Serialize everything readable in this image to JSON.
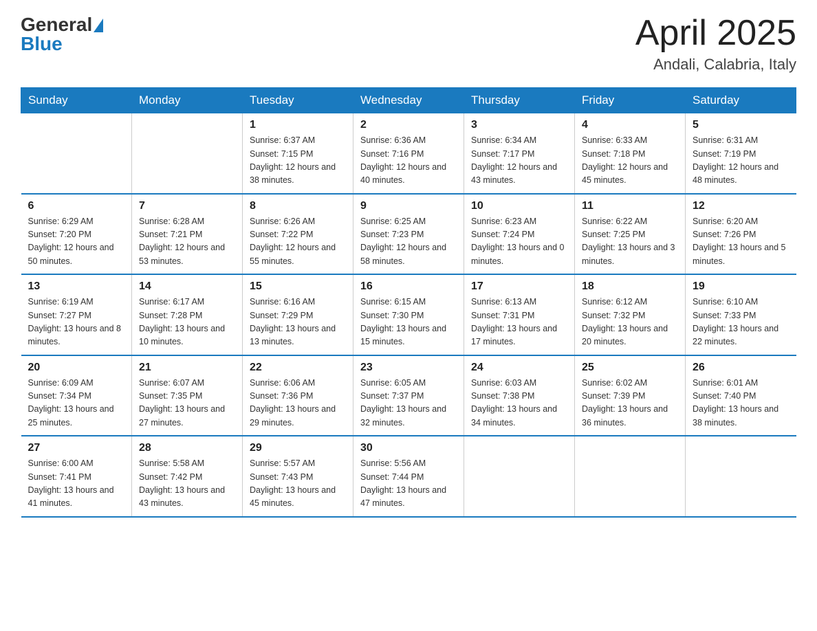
{
  "header": {
    "logo": {
      "general": "General",
      "blue": "Blue"
    },
    "title": "April 2025",
    "subtitle": "Andali, Calabria, Italy"
  },
  "weekdays": [
    "Sunday",
    "Monday",
    "Tuesday",
    "Wednesday",
    "Thursday",
    "Friday",
    "Saturday"
  ],
  "weeks": [
    [
      {
        "day": "",
        "info": ""
      },
      {
        "day": "",
        "info": ""
      },
      {
        "day": "1",
        "info": "Sunrise: 6:37 AM\nSunset: 7:15 PM\nDaylight: 12 hours\nand 38 minutes."
      },
      {
        "day": "2",
        "info": "Sunrise: 6:36 AM\nSunset: 7:16 PM\nDaylight: 12 hours\nand 40 minutes."
      },
      {
        "day": "3",
        "info": "Sunrise: 6:34 AM\nSunset: 7:17 PM\nDaylight: 12 hours\nand 43 minutes."
      },
      {
        "day": "4",
        "info": "Sunrise: 6:33 AM\nSunset: 7:18 PM\nDaylight: 12 hours\nand 45 minutes."
      },
      {
        "day": "5",
        "info": "Sunrise: 6:31 AM\nSunset: 7:19 PM\nDaylight: 12 hours\nand 48 minutes."
      }
    ],
    [
      {
        "day": "6",
        "info": "Sunrise: 6:29 AM\nSunset: 7:20 PM\nDaylight: 12 hours\nand 50 minutes."
      },
      {
        "day": "7",
        "info": "Sunrise: 6:28 AM\nSunset: 7:21 PM\nDaylight: 12 hours\nand 53 minutes."
      },
      {
        "day": "8",
        "info": "Sunrise: 6:26 AM\nSunset: 7:22 PM\nDaylight: 12 hours\nand 55 minutes."
      },
      {
        "day": "9",
        "info": "Sunrise: 6:25 AM\nSunset: 7:23 PM\nDaylight: 12 hours\nand 58 minutes."
      },
      {
        "day": "10",
        "info": "Sunrise: 6:23 AM\nSunset: 7:24 PM\nDaylight: 13 hours\nand 0 minutes."
      },
      {
        "day": "11",
        "info": "Sunrise: 6:22 AM\nSunset: 7:25 PM\nDaylight: 13 hours\nand 3 minutes."
      },
      {
        "day": "12",
        "info": "Sunrise: 6:20 AM\nSunset: 7:26 PM\nDaylight: 13 hours\nand 5 minutes."
      }
    ],
    [
      {
        "day": "13",
        "info": "Sunrise: 6:19 AM\nSunset: 7:27 PM\nDaylight: 13 hours\nand 8 minutes."
      },
      {
        "day": "14",
        "info": "Sunrise: 6:17 AM\nSunset: 7:28 PM\nDaylight: 13 hours\nand 10 minutes."
      },
      {
        "day": "15",
        "info": "Sunrise: 6:16 AM\nSunset: 7:29 PM\nDaylight: 13 hours\nand 13 minutes."
      },
      {
        "day": "16",
        "info": "Sunrise: 6:15 AM\nSunset: 7:30 PM\nDaylight: 13 hours\nand 15 minutes."
      },
      {
        "day": "17",
        "info": "Sunrise: 6:13 AM\nSunset: 7:31 PM\nDaylight: 13 hours\nand 17 minutes."
      },
      {
        "day": "18",
        "info": "Sunrise: 6:12 AM\nSunset: 7:32 PM\nDaylight: 13 hours\nand 20 minutes."
      },
      {
        "day": "19",
        "info": "Sunrise: 6:10 AM\nSunset: 7:33 PM\nDaylight: 13 hours\nand 22 minutes."
      }
    ],
    [
      {
        "day": "20",
        "info": "Sunrise: 6:09 AM\nSunset: 7:34 PM\nDaylight: 13 hours\nand 25 minutes."
      },
      {
        "day": "21",
        "info": "Sunrise: 6:07 AM\nSunset: 7:35 PM\nDaylight: 13 hours\nand 27 minutes."
      },
      {
        "day": "22",
        "info": "Sunrise: 6:06 AM\nSunset: 7:36 PM\nDaylight: 13 hours\nand 29 minutes."
      },
      {
        "day": "23",
        "info": "Sunrise: 6:05 AM\nSunset: 7:37 PM\nDaylight: 13 hours\nand 32 minutes."
      },
      {
        "day": "24",
        "info": "Sunrise: 6:03 AM\nSunset: 7:38 PM\nDaylight: 13 hours\nand 34 minutes."
      },
      {
        "day": "25",
        "info": "Sunrise: 6:02 AM\nSunset: 7:39 PM\nDaylight: 13 hours\nand 36 minutes."
      },
      {
        "day": "26",
        "info": "Sunrise: 6:01 AM\nSunset: 7:40 PM\nDaylight: 13 hours\nand 38 minutes."
      }
    ],
    [
      {
        "day": "27",
        "info": "Sunrise: 6:00 AM\nSunset: 7:41 PM\nDaylight: 13 hours\nand 41 minutes."
      },
      {
        "day": "28",
        "info": "Sunrise: 5:58 AM\nSunset: 7:42 PM\nDaylight: 13 hours\nand 43 minutes."
      },
      {
        "day": "29",
        "info": "Sunrise: 5:57 AM\nSunset: 7:43 PM\nDaylight: 13 hours\nand 45 minutes."
      },
      {
        "day": "30",
        "info": "Sunrise: 5:56 AM\nSunset: 7:44 PM\nDaylight: 13 hours\nand 47 minutes."
      },
      {
        "day": "",
        "info": ""
      },
      {
        "day": "",
        "info": ""
      },
      {
        "day": "",
        "info": ""
      }
    ]
  ]
}
